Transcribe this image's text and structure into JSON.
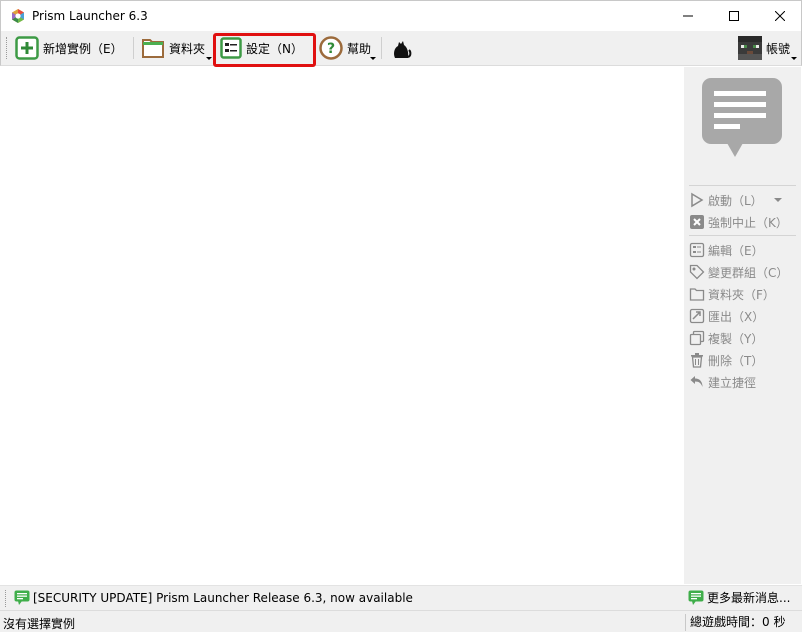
{
  "window": {
    "title": "Prism Launcher 6.3"
  },
  "toolbar": {
    "add_instance": "新增實例（E）",
    "folders": "資料夾",
    "settings": "設定（N）",
    "help": "幫助",
    "accounts": "帳號"
  },
  "side_panel": {
    "items": [
      {
        "label": "啟動（L）",
        "icon": "play-icon"
      },
      {
        "label": "強制中止（K）",
        "icon": "kill-icon"
      },
      {
        "label": "編輯（E）",
        "icon": "edit-icon"
      },
      {
        "label": "變更群組（C）",
        "icon": "tag-icon"
      },
      {
        "label": "資料夾（F）",
        "icon": "folder-icon"
      },
      {
        "label": "匯出（X）",
        "icon": "export-icon"
      },
      {
        "label": "複製（Y）",
        "icon": "copy-icon"
      },
      {
        "label": "刪除（T）",
        "icon": "trash-icon"
      },
      {
        "label": "建立捷徑",
        "icon": "shortcut-icon"
      }
    ]
  },
  "news": {
    "headline": "[SECURITY UPDATE] Prism Launcher Release 6.3, now available",
    "more": "更多最新消息..."
  },
  "status": {
    "left": "沒有選擇實例",
    "right": "總遊戲時間：0 秒"
  },
  "colors": {
    "highlight": "#e01010",
    "news_icon": "#3fae4a",
    "disabled_text": "#8a8a8a"
  }
}
